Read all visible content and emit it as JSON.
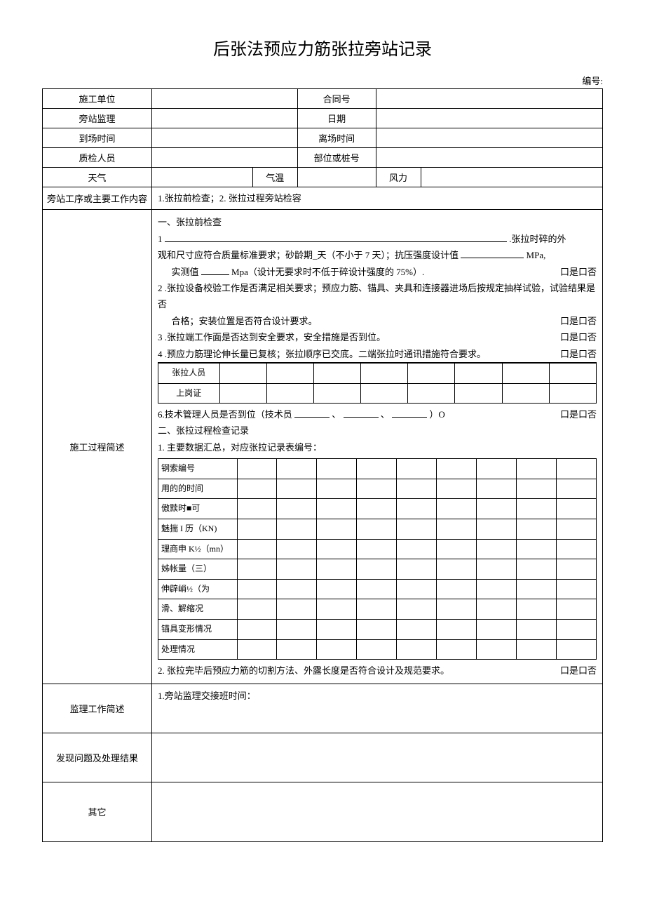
{
  "title": "后张法预应力筋张拉旁站记录",
  "numbering_label": "编号:",
  "header": {
    "construction_unit_label": "施工单位",
    "contract_no_label": "合同号",
    "supervisor_label": "旁站监理",
    "date_label": "日期",
    "arrival_label": "到场时间",
    "departure_label": "离场时间",
    "qc_label": "质检人员",
    "part_pile_label": "部位或桩号",
    "weather_label": "天气",
    "temperature_label": "气温",
    "wind_label": "风力"
  },
  "process_label": "旁站工序或主要工作内容",
  "process_content": "1.张拉前检查；2. 张拉过程旁站检容",
  "description_label": "施工过程简述",
  "part1": {
    "title": "一、张拉前检查",
    "item1_prefix": "1",
    "item1_suffix": ".张拉时碎的外",
    "item1_line2a": "观和尺寸应符合质量标准要求；砂龄期_天（不小于 7 天）；抗压强度设计值 ",
    "item1_line2b": "MPa,",
    "item1_line3a": "实测值 ",
    "item1_line3b": "Mpa（设计无要求时不低于碎设计强度的 75%）.",
    "yesno": "口是口否",
    "item2": "2 .张拉设备校验工作是否满足相关要求；预应力筋、锚具、夹具和连接器进场后按规定抽样试验，试验结果是否",
    "item2b": "合格；安装位置是否符合设计要求。",
    "item3": "3      .张拉端工作面是否达到安全要求，安全措施是否到位。",
    "item4": "4      .预应力筋理论伸长量已复核；张拉顺序已交底。二端张拉时通讯措施符合要求。",
    "person_row_label": "张拉人员",
    "cert_row_label": "上岗证",
    "item6a": "6.技术管理人员是否到位（技术员 ",
    "item6b": "、",
    "item6c": "、",
    "item6d": "）O"
  },
  "part2": {
    "title": "二、张拉过程检查记录",
    "item1": "1. 主要数据汇总，对应张拉记录表编号：",
    "rows": {
      "r1": "钢索编号",
      "r2": "用的的时间",
      "r3": "傲黩时■可",
      "r4": "魅揣 I 历（KN)",
      "r5": "理商申 K½（mn）",
      "r6": "姊帐量（三）",
      "r7": "伸辟峭½（为",
      "r8": "滑、解缩况",
      "r9": "锚具变形情况",
      "r10": "处理情况"
    },
    "item2": "2. 张拉完毕后预应力筋的切割方法、外露长度是否符合设计及规范要求。",
    "yesno": "口是口否"
  },
  "supervision_label": "监理工作简述",
  "supervision_content": "1.旁站监理交接班时间：",
  "issues_label": "发现问题及处理结果",
  "other_label": "其它"
}
